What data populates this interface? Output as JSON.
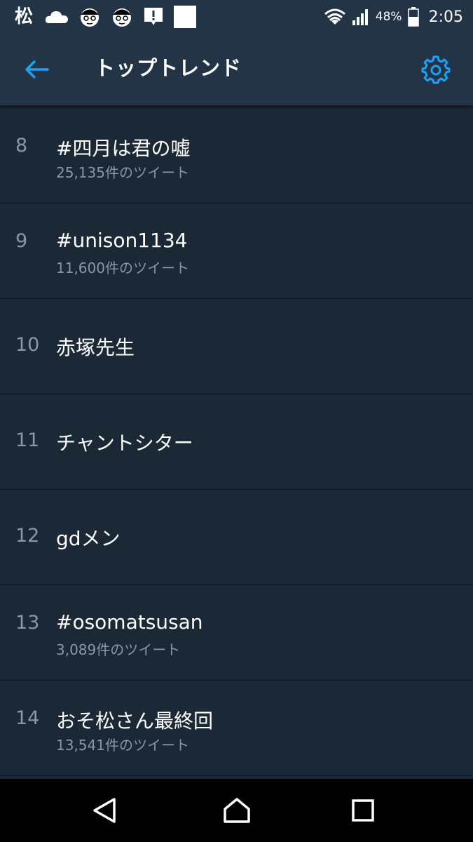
{
  "status_bar": {
    "app_char": "松",
    "battery_percent": "48%",
    "time": "2:05"
  },
  "header": {
    "title": "トップトレンド",
    "accent_color": "#1da1f2"
  },
  "trends": [
    {
      "rank": "8",
      "name": "#四月は君の嘘",
      "count": "25,135件のツイート"
    },
    {
      "rank": "9",
      "name": "#unison1134",
      "count": "11,600件のツイート"
    },
    {
      "rank": "10",
      "name": "赤塚先生",
      "count": ""
    },
    {
      "rank": "11",
      "name": "チャントシター",
      "count": ""
    },
    {
      "rank": "12",
      "name": "gdメン",
      "count": ""
    },
    {
      "rank": "13",
      "name": "#osomatsusan",
      "count": "3,089件のツイート"
    },
    {
      "rank": "14",
      "name": "おそ松さん最終回",
      "count": "13,541件のツイート"
    }
  ],
  "icons": {
    "status_left": [
      "cloud-icon",
      "face-icon",
      "face-icon",
      "alert-icon",
      "square-icon"
    ],
    "status_right": [
      "wifi-icon",
      "signal-icon",
      "battery-icon"
    ],
    "header": [
      "back-arrow-icon",
      "gear-icon"
    ],
    "nav": [
      "back-triangle-icon",
      "home-icon",
      "recents-icon"
    ]
  }
}
